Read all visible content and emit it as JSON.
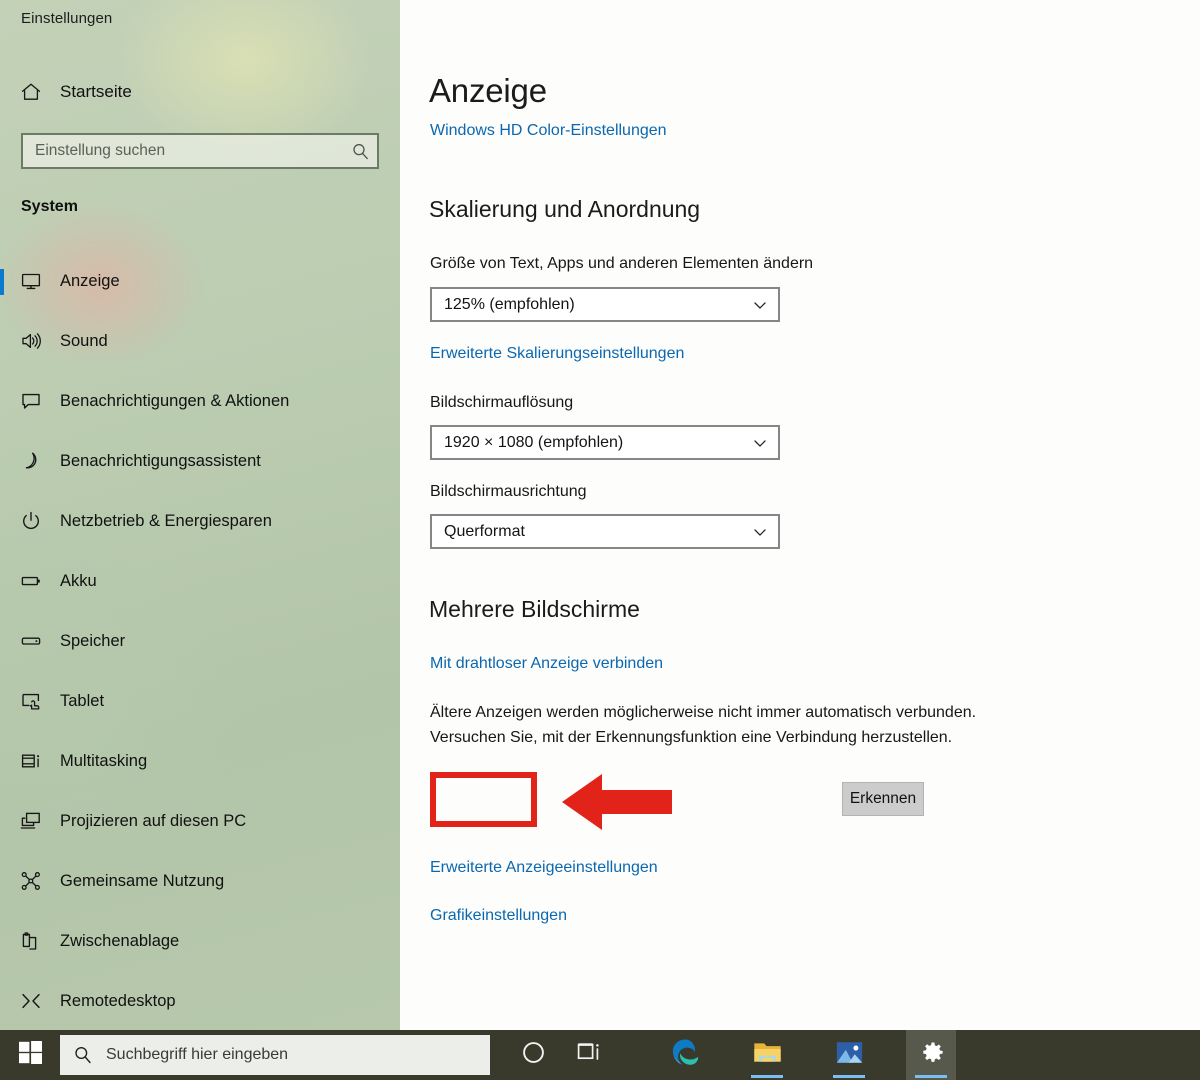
{
  "window": {
    "title": "Einstellungen"
  },
  "sidebar": {
    "home": {
      "label": "Startseite",
      "icon": "home-icon"
    },
    "search": {
      "placeholder": "Einstellung suchen",
      "value": "",
      "icon": "search-icon"
    },
    "section_heading": "System",
    "accent_color": "#0a7ad1",
    "items": [
      {
        "label": "Anzeige",
        "icon": "monitor-icon",
        "selected": true
      },
      {
        "label": "Sound",
        "icon": "speaker-icon",
        "selected": false
      },
      {
        "label": "Benachrichtigungen & Aktionen",
        "icon": "chat-bubble-icon",
        "selected": false
      },
      {
        "label": "Benachrichtigungsassistent",
        "icon": "moon-icon",
        "selected": false
      },
      {
        "label": "Netzbetrieb & Energiesparen",
        "icon": "power-icon",
        "selected": false
      },
      {
        "label": "Akku",
        "icon": "battery-icon",
        "selected": false
      },
      {
        "label": "Speicher",
        "icon": "storage-icon",
        "selected": false
      },
      {
        "label": "Tablet",
        "icon": "tablet-icon",
        "selected": false
      },
      {
        "label": "Multitasking",
        "icon": "multitasking-icon",
        "selected": false
      },
      {
        "label": "Projizieren auf diesen PC",
        "icon": "project-icon",
        "selected": false
      },
      {
        "label": "Gemeinsame Nutzung",
        "icon": "share-icon",
        "selected": false
      },
      {
        "label": "Zwischenablage",
        "icon": "clipboard-icon",
        "selected": false
      },
      {
        "label": "Remotedesktop",
        "icon": "remote-icon",
        "selected": false
      }
    ]
  },
  "main": {
    "page_title": "Anzeige",
    "hd_color_link": "Windows HD Color-Einstellungen",
    "scaling": {
      "heading": "Skalierung und Anordnung",
      "scale_label": "Größe von Text, Apps und anderen Elementen ändern",
      "scale_value": "125% (empfohlen)",
      "advanced_scaling_link": "Erweiterte Skalierungseinstellungen",
      "resolution_label": "Bildschirmauflösung",
      "resolution_value": "1920 × 1080 (empfohlen)",
      "orientation_label": "Bildschirmausrichtung",
      "orientation_value": "Querformat"
    },
    "multiple_displays": {
      "heading": "Mehrere Bildschirme",
      "wireless_link": "Mit drahtloser Anzeige verbinden",
      "description": "Ältere Anzeigen werden möglicherweise nicht immer automatisch verbunden. Versuchen Sie, mit der Erkennungsfunktion eine Verbindung herzustellen.",
      "detect_button": "Erkennen",
      "advanced_display_link": "Erweiterte Anzeigeeinstellungen",
      "graphics_link": "Grafikeinstellungen"
    }
  },
  "annotation": {
    "highlight_color": "#e2231a",
    "arrow_direction": "left",
    "target": "Erkennen"
  },
  "taskbar": {
    "start_icon": "windows-logo-icon",
    "search_placeholder": "Suchbegriff hier eingeben",
    "search_value": "",
    "search_icon": "search-icon",
    "buttons": [
      {
        "name": "cortana-icon",
        "running": false,
        "active": false
      },
      {
        "name": "task-view-icon",
        "running": false,
        "active": false
      },
      {
        "name": "edge-icon",
        "running": false,
        "active": false
      },
      {
        "name": "file-explorer-icon",
        "running": true,
        "active": false
      },
      {
        "name": "photos-icon",
        "running": true,
        "active": false
      },
      {
        "name": "settings-gear-icon",
        "running": true,
        "active": true
      }
    ]
  }
}
